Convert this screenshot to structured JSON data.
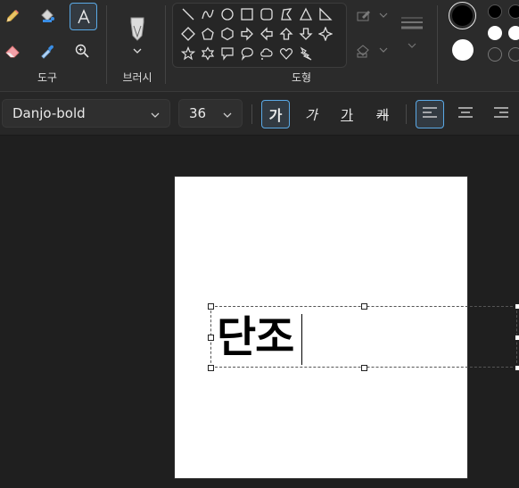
{
  "ribbon": {
    "groups": {
      "tools": "도구",
      "brushes": "브러시",
      "shapes": "도형"
    },
    "active_tool": "text",
    "colors": {
      "primary": "#000000",
      "secondary": "#ffffff",
      "palette": [
        "#000000",
        "#000000",
        "#ffffff",
        "#ffffff",
        "#2b2b2b",
        "#2b2b2b"
      ]
    }
  },
  "textbar": {
    "font_family": "Danjo-bold",
    "font_size": "36",
    "bold_glyph": "가",
    "italic_glyph": "가",
    "underline_glyph": "가",
    "strike_glyph": "캐",
    "active_format": "bold",
    "active_align": "left"
  },
  "canvas": {
    "text": "단조",
    "background": "#ffffff"
  }
}
